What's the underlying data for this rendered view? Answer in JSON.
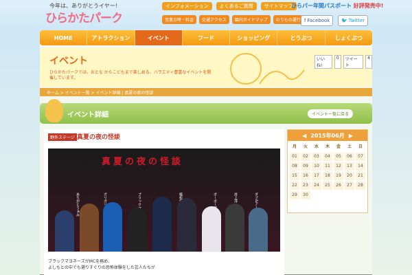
{
  "header": {
    "tagline": "今年は、ありがとうイヤー!",
    "logo": "ひらかたパーク",
    "top_links": [
      "インフォメーション",
      "よくあるご質問",
      "サイトマップ"
    ],
    "passport": "ひらパー年間パスポート",
    "passport_badge": "好評発売中!",
    "sub_links": [
      "営業日時・料金",
      "交通アクセス",
      "園内ガイドマップ",
      "のりもの運行状況"
    ],
    "facebook": "Facebook",
    "twitter": "Twitter"
  },
  "nav": [
    "HOME",
    "アトラクション",
    "イベント",
    "フード",
    "ショッピング",
    "とうぶつ",
    "しょくぶつ"
  ],
  "banner": {
    "title": "イベント",
    "desc": "ひらかたパークでは、おとな からこどもまで楽しめる、バラエティ豊富なイベントを開催しています。",
    "like": "いいね!",
    "like_count": "0",
    "tweet": "ツイート",
    "tweet_count": "4"
  },
  "breadcrumb": "ホーム > イベント一覧 > イベント詳細 | 真夏の夜の怪談",
  "detail": {
    "title": "イベント詳細",
    "back": "イベント一覧に戻る"
  },
  "event": {
    "tag": "野外ステージ",
    "title": "真夏の夜の怪談",
    "poster_title": "真夏の夜の怪談",
    "cast": [
      "ありがとうぁみ",
      "ガリガリガリクソン",
      "ブラックマヨネーズ",
      "植松俊典",
      "ボーボー野球小僧",
      "井上淳一",
      "ダブ&アート"
    ],
    "desc_line1": "ブラックマヨネーズがMCを務め、",
    "desc_line2": "よしもとの中でも選りすぐりの恐怖体験をした芸人たちが"
  },
  "calendar": {
    "month": "2015年06月",
    "dow": [
      "月",
      "火",
      "水",
      "木",
      "金",
      "土",
      "日"
    ],
    "days": [
      "01",
      "02",
      "03",
      "04",
      "05",
      "06",
      "07",
      "08",
      "09",
      "10",
      "11",
      "12",
      "13",
      "14",
      "15",
      "16",
      "17",
      "18",
      "19",
      "20",
      "21",
      "22",
      "23",
      "24",
      "25",
      "26",
      "27",
      "28",
      "29",
      "30"
    ]
  }
}
